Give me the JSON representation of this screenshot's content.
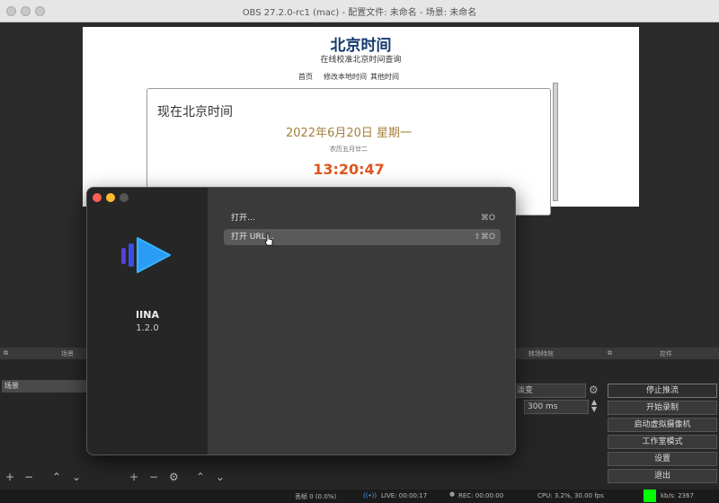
{
  "window": {
    "title": "OBS 27.2.0-rc1 (mac) - 配置文件: 未命名 - 场景: 未命名"
  },
  "web_page": {
    "title": "北京时间",
    "subtitle": "在线校准北京时间查询",
    "nav": [
      "首页",
      "修改本地时间",
      "其他时间"
    ],
    "card": {
      "heading": "现在北京时间",
      "date": "2022年6月20日 星期一",
      "lunar": "农历五月廿二",
      "time": "13:20:47"
    }
  },
  "obs": {
    "panels": {
      "scenes_header": "场景",
      "sources_header": "来源",
      "scene_item": "场景",
      "transitions_header": "转场特效",
      "controls_header": "控件",
      "transition_value": "淡变",
      "duration_value": "300 ms"
    },
    "controls": {
      "stop_stream": "停止推流",
      "start_record": "开始录制",
      "virtual_cam": "启动虚拟摄像机",
      "studio_mode": "工作室模式",
      "settings": "设置",
      "exit": "退出"
    },
    "status": {
      "dropped": "丢帧 0 (0.0%)",
      "live": "LIVE: 00:00:17",
      "rec": "REC: 00:00:00",
      "cpu": "CPU: 3.2%, 30.00 fps",
      "kbps": "kb/s: 2367"
    },
    "accent_color": "#00ff00"
  },
  "iina": {
    "app_name": "IINA",
    "version": "1.2.0",
    "menu": [
      {
        "label": "打开…",
        "shortcut": "⌘O"
      },
      {
        "label": "打开 URL…",
        "shortcut": "⇧⌘O"
      }
    ]
  }
}
